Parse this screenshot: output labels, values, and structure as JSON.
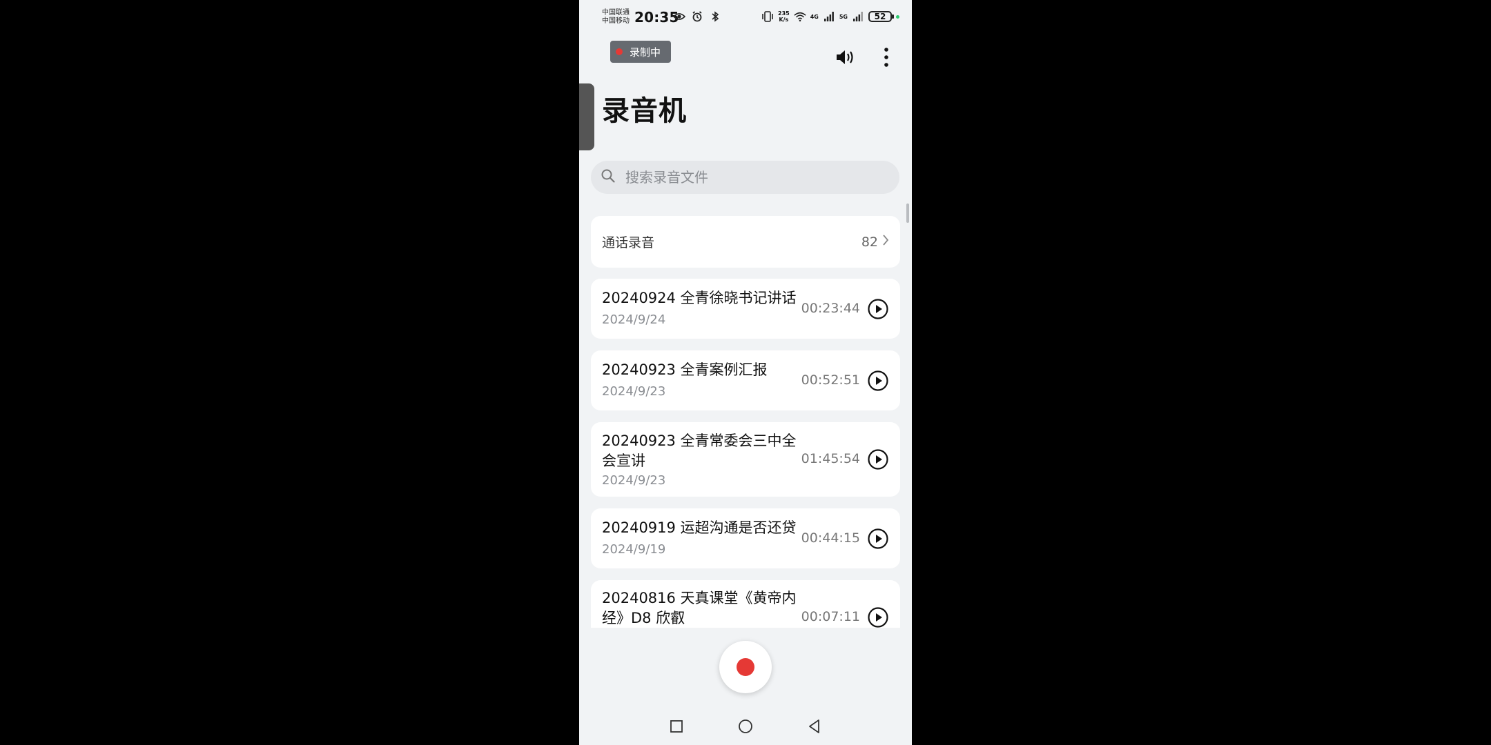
{
  "status_bar": {
    "carrier_1": "中国联通",
    "carrier_2": "中国移动",
    "time": "20:35",
    "net_speed_value": "235",
    "net_speed_unit": "K/s",
    "signal_1_label": "4G",
    "signal_2_label": "5G",
    "battery": "52",
    "icons": [
      "eye-icon",
      "alarm-icon",
      "bluetooth-icon",
      "vibrate-icon",
      "wifi-icon",
      "signal-icon",
      "battery-icon"
    ]
  },
  "recording_chip": {
    "label": "录制中"
  },
  "header": {
    "title": "录音机",
    "actions": [
      "speaker-icon",
      "more-icon"
    ]
  },
  "search": {
    "placeholder": "搜索录音文件"
  },
  "call_records": {
    "label": "通话录音",
    "count": "82"
  },
  "recordings": [
    {
      "title": "20240924 全青徐晓书记讲话",
      "date": "2024/9/24",
      "duration": "00:23:44"
    },
    {
      "title": "20240923 全青案例汇报",
      "date": "2024/9/23",
      "duration": "00:52:51"
    },
    {
      "title": "20240923 全青常委会三中全会宣讲",
      "date": "2024/9/23",
      "duration": "01:45:54"
    },
    {
      "title": "20240919 运超沟通是否还贷",
      "date": "2024/9/19",
      "duration": "00:44:15"
    },
    {
      "title": "20240816 天真课堂《黄帝内经》D8 欣叡",
      "date": "",
      "duration": "00:07:11"
    }
  ],
  "colors": {
    "accent_red": "#e53935",
    "background": "#f1f3f5",
    "card": "#ffffff"
  }
}
